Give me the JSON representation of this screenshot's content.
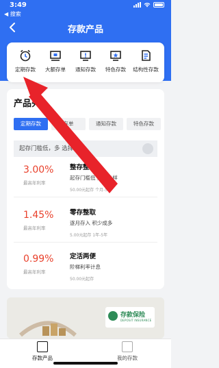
{
  "status_bar": {
    "time": "3:49",
    "back_app": "◀ 搜索"
  },
  "nav": {
    "title": "存款产品"
  },
  "categories": [
    {
      "label": "定期存款",
      "icon": "alarm-clock-icon"
    },
    {
      "label": "大额存单",
      "icon": "certificate-icon"
    },
    {
      "label": "通知存款",
      "icon": "notice-icon"
    },
    {
      "label": "特色存款",
      "icon": "special-deposit-icon"
    },
    {
      "label": "结构性存款",
      "icon": "structured-deposit-icon"
    }
  ],
  "products": {
    "title": "产品列",
    "tabs": [
      "定期存款",
      "存单",
      "通知存款",
      "特色存款"
    ],
    "filter_text": "起存门槛低，多   选择",
    "items": [
      {
        "rate": "3.00%",
        "rate_label": "最高年利率",
        "name": "整存整取",
        "desc": "起存门槛低  期限多样",
        "term": "50.00元起存  个月-5年"
      },
      {
        "rate": "1.45%",
        "rate_label": "最高年利率",
        "name": "零存整取",
        "desc": "逐月存入  积少成多",
        "term": "5.00元起存  1年-5年"
      },
      {
        "rate": "0.99%",
        "rate_label": "最高年利率",
        "name": "定活两便",
        "desc": "阶梯利率计息",
        "term": "50.00元起存"
      }
    ]
  },
  "banner": {
    "logo_text": "存款保险",
    "logo_sub": "DEPOSIT INSURANCE"
  },
  "bottom_nav": [
    {
      "label": "存款产品",
      "active": true
    },
    {
      "label": "我的存款",
      "active": false
    }
  ],
  "colors": {
    "primary": "#2f6ff2",
    "rate_red": "#e9412c",
    "arrow_red": "#e8232a"
  }
}
